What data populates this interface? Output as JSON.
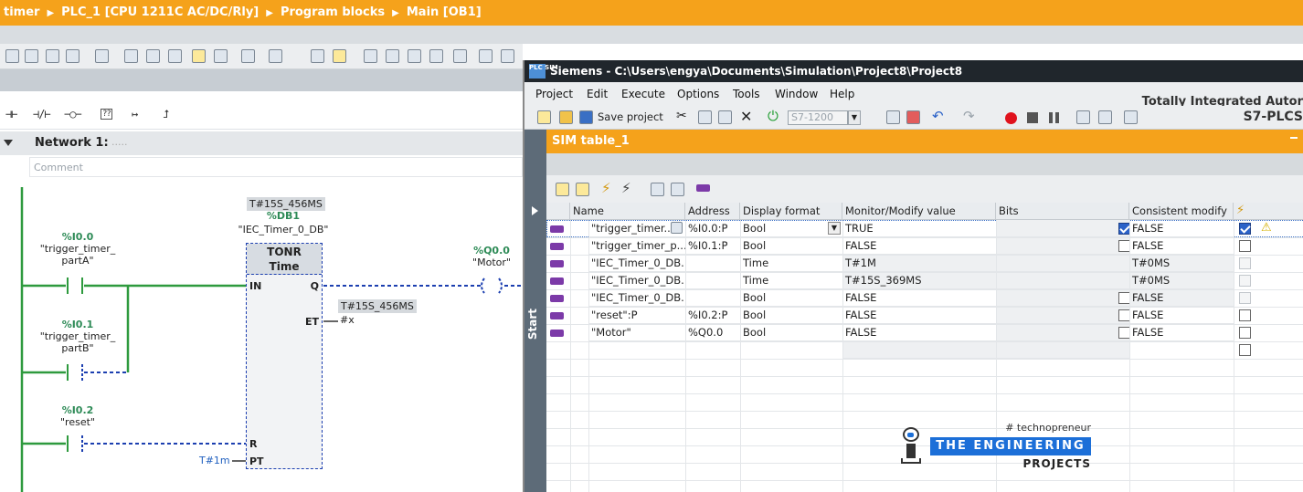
{
  "breadcrumb": [
    "timer",
    "PLC_1 [CPU 1211C AC/DC/Rly]",
    "Program blocks",
    "Main [OB1]"
  ],
  "instructions": [
    "⊣⊢",
    "⊣/⊢",
    "−○−",
    "??",
    "↦",
    "⮥"
  ],
  "network": {
    "title": "Network 1:",
    "dots": ".....",
    "comment_placeholder": "Comment"
  },
  "ladder": {
    "contact_a": {
      "addr": "%I0.0",
      "name1": "\"trigger_timer_",
      "name2": "partA\""
    },
    "contact_b": {
      "addr": "%I0.1",
      "name1": "\"trigger_timer_",
      "name2": "partB\""
    },
    "contact_reset": {
      "addr": "%I0.2",
      "name": "\"reset\""
    },
    "timer": {
      "preset_value": "T#15S_456MS",
      "db_addr": "%DB1",
      "db_name": "\"IEC_Timer_0_DB\"",
      "type": "TONR",
      "subtitle": "Time",
      "pin_in": "IN",
      "pin_q": "Q",
      "pin_et": "ET",
      "pin_r": "R",
      "pin_pt": "PT",
      "et_value": "T#15S_456MS",
      "et_var": "#x",
      "pt_value": "T#1m"
    },
    "coil": {
      "addr": "%Q0.0",
      "name": "\"Motor\""
    }
  },
  "sim": {
    "title": "Siemens  -  C:\\Users\\engya\\Documents\\Simulation\\Project8\\Project8",
    "logo": "PLC SIM",
    "menu": [
      "Project",
      "Edit",
      "Execute",
      "Options",
      "Tools",
      "Window",
      "Help"
    ],
    "save_label": "Save project",
    "cpu_select": "S7-1200",
    "brand_line1": "Totally Integrated Autor",
    "brand_line2": "S7-PLCS",
    "side_label": "Start",
    "table_title": "SIM table_1"
  },
  "table": {
    "columns": [
      "Name",
      "Address",
      "Display format",
      "Monitor/Modify value",
      "Bits",
      "Consistent modify"
    ],
    "rows": [
      {
        "name": "\"trigger_timer...",
        "address": "%I0.0:P",
        "format": "Bool",
        "value": "TRUE",
        "bit": "checked",
        "consistent": "FALSE",
        "consistent_cb": "checked",
        "warn": true
      },
      {
        "name": "\"trigger_timer_p...",
        "address": "%I0.1:P",
        "format": "Bool",
        "value": "FALSE",
        "bit": "unchecked",
        "consistent": "FALSE",
        "consistent_cb": "unchecked",
        "warn": false
      },
      {
        "name": "\"IEC_Timer_0_DB...",
        "address": "",
        "format": "Time",
        "value": "T#1M",
        "bit": "none",
        "consistent": "T#0MS",
        "consistent_cb": "disabled",
        "warn": false
      },
      {
        "name": "\"IEC_Timer_0_DB...",
        "address": "",
        "format": "Time",
        "value": "T#15S_369MS",
        "bit": "none",
        "consistent": "T#0MS",
        "consistent_cb": "disabled",
        "warn": false
      },
      {
        "name": "\"IEC_Timer_0_DB...",
        "address": "",
        "format": "Bool",
        "value": "FALSE",
        "bit": "unchecked",
        "consistent": "FALSE",
        "consistent_cb": "disabled",
        "warn": false
      },
      {
        "name": "\"reset\":P",
        "address": "%I0.2:P",
        "format": "Bool",
        "value": "FALSE",
        "bit": "unchecked",
        "consistent": "FALSE",
        "consistent_cb": "unchecked",
        "warn": false
      },
      {
        "name": "\"Motor\"",
        "address": "%Q0.0",
        "format": "Bool",
        "value": "FALSE",
        "bit": "unchecked",
        "consistent": "FALSE",
        "consistent_cb": "unchecked",
        "warn": false
      }
    ]
  },
  "watermark": {
    "tag": "# technopreneur",
    "brand": "THE ENGINEERING",
    "sub": "PROJECTS"
  },
  "colors": {
    "accent": "#f5a21b",
    "wire": "#2e9a3e",
    "dashed": "#1c3fb0",
    "title_bar": "#20262c"
  }
}
